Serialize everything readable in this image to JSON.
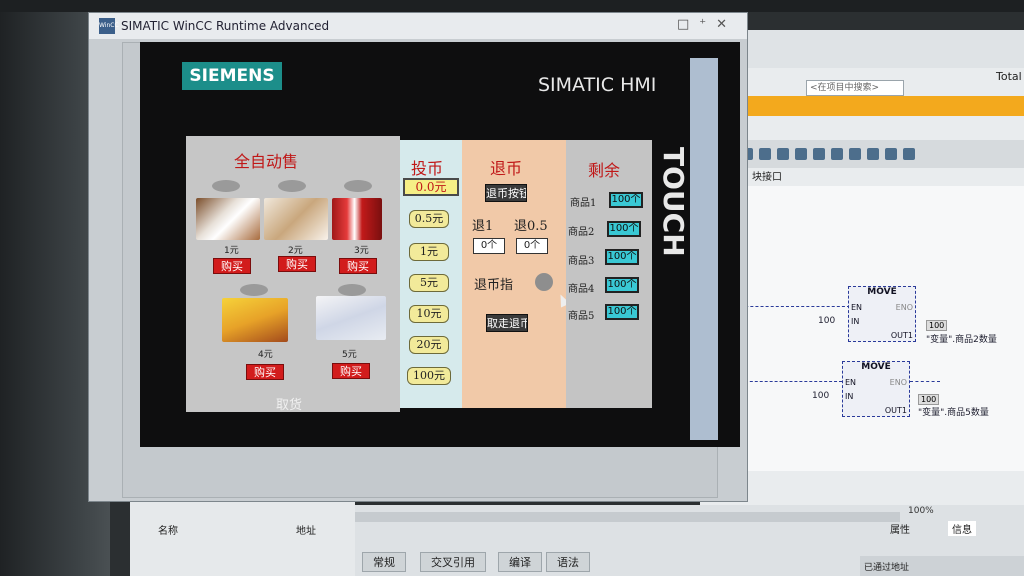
{
  "window": {
    "title": "SIMATIC WinCC Runtime Advanced",
    "logo_text": "WinCC"
  },
  "hmi": {
    "brand_logo": "SIEMENS",
    "brand": "SIMATIC HMI",
    "touch_label": "TOUCH"
  },
  "vending": {
    "main_title": "全自动售",
    "products": [
      {
        "number": "1元",
        "buy_label": "购买"
      },
      {
        "number": "2元",
        "buy_label": "购买"
      },
      {
        "number": "3元",
        "buy_label": "购买"
      },
      {
        "number": "4元",
        "buy_label": "购买"
      },
      {
        "number": "5元",
        "buy_label": "购买"
      }
    ],
    "cancel_label": "取货",
    "coin": {
      "header": "投币",
      "display": "0.0元",
      "buttons": [
        "0.5元",
        "1元",
        "5元",
        "10元",
        "20元",
        "100元"
      ]
    },
    "refund": {
      "header": "退币",
      "button_label": "退币按钮",
      "label_1": "退1",
      "label_05": "退0.5",
      "count_1": "0个",
      "count_05": "0个",
      "indicator_label": "退币指",
      "take_label": "取走退币"
    },
    "remaining": {
      "header": "剩余",
      "items": [
        {
          "label": "商品1",
          "value": "100个"
        },
        {
          "label": "商品2",
          "value": "100个"
        },
        {
          "label": "商品3",
          "value": "100个"
        },
        {
          "label": "商品4",
          "value": "100个"
        },
        {
          "label": "商品5",
          "value": "100个"
        }
      ]
    }
  },
  "tia": {
    "search_placeholder": "<在项目中搜索>",
    "total_label": "Total",
    "io_label": "块接口",
    "move_blocks": [
      {
        "title": "MOVE",
        "en": "EN",
        "eno": "ENO",
        "in": "IN",
        "out": "OUT1",
        "in_value": "100",
        "out_value": "100",
        "out_var": "\"变量\".商品2数量"
      },
      {
        "title": "MOVE",
        "en": "EN",
        "eno": "ENO",
        "in": "IN",
        "out": "OUT1",
        "in_value": "100",
        "out_value": "100",
        "out_var": "\"变量\".商品5数量"
      }
    ],
    "zoom": "100%",
    "props_tab": "属性",
    "info_tab": "信息",
    "columns": {
      "name": "名称",
      "address": "地址"
    },
    "bottom_tabs": [
      "常规",
      "交叉引用",
      "编译",
      "语法"
    ],
    "status_text": "已通过地址"
  },
  "colors": {
    "siemens_teal": "#1c8e8a",
    "buy_red": "#d21c1c",
    "remain_cyan": "#39c8d4",
    "header_red": "#c01818"
  }
}
